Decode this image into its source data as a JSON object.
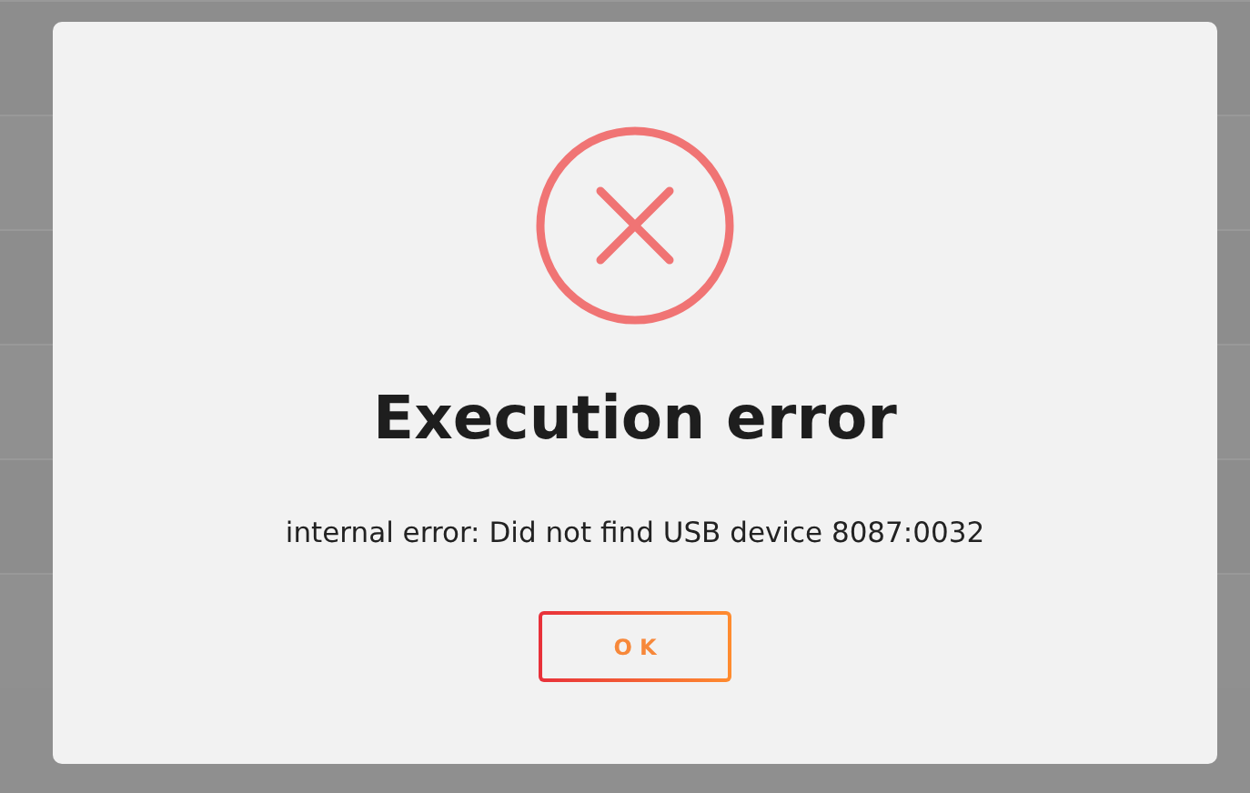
{
  "dialog": {
    "kind": "error",
    "title": "Execution error",
    "message": "internal error: Did not find USB device 8087:0032",
    "buttons": [
      "OK"
    ]
  }
}
